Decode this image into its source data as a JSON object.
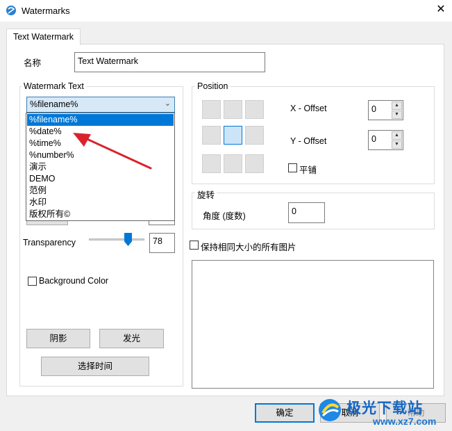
{
  "window": {
    "title": "Watermarks"
  },
  "tabs": [
    {
      "label": "Text Watermark"
    }
  ],
  "name_field": {
    "label": "名称",
    "value": "Text Watermark"
  },
  "watermark_text": {
    "group_label": "Watermark Text",
    "selected": "%filename%",
    "options": [
      "%filename%",
      "%date%",
      "%time%",
      "%number%",
      "演示",
      "DEMO",
      "范例",
      "水印",
      "版权所有©"
    ]
  },
  "transparency": {
    "label": "Transparency",
    "value": "78",
    "level_percent": 78
  },
  "background_color": {
    "label": "Background Color",
    "checked": false
  },
  "buttons": {
    "shadow": "阴影",
    "glow": "发光",
    "select_time": "选择时间"
  },
  "position": {
    "group_label": "Position",
    "selected_cell": 4,
    "x_offset": {
      "label": "X - Offset",
      "value": "0"
    },
    "y_offset": {
      "label": "Y - Offset",
      "value": "0"
    },
    "tile": {
      "label": "平铺",
      "checked": false
    }
  },
  "rotation": {
    "group_label": "旋转",
    "label": "角度 (度数)",
    "value": "0"
  },
  "keep_same_size": {
    "label": "保持相同大小的所有图片",
    "checked": false
  },
  "footer": {
    "ok": "确定",
    "cancel": "取消",
    "help": "帮助"
  },
  "site_watermark": {
    "brand": "极光下载站",
    "url": "www.xz7.com"
  },
  "colors": {
    "accent": "#0078d7",
    "arrow": "#d9232c"
  }
}
